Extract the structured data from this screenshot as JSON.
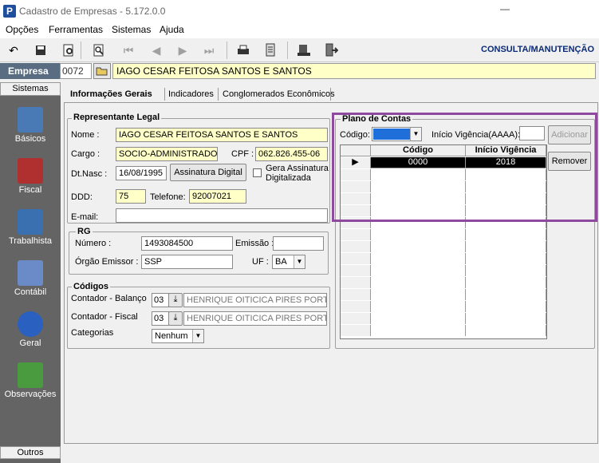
{
  "window": {
    "title": "Cadastro de Empresas - 5.172.0.0",
    "app_icon_letter": "P",
    "minimize_glyph": "—"
  },
  "menu": [
    "Opções",
    "Ferramentas",
    "Sistemas",
    "Ajuda"
  ],
  "toolbar": {
    "mode_label": "CONSULTA/MANUTENÇÃO"
  },
  "empresa": {
    "label": "Empresa",
    "code": "0072",
    "name": "IAGO CESAR FEITOSA SANTOS E SANTOS"
  },
  "sidebar": {
    "top_label": "Sistemas",
    "bottom_label": "Outros",
    "items": [
      {
        "label": "Básicos",
        "icon": "books-icon",
        "color": "#4a7ab5"
      },
      {
        "label": "Fiscal",
        "icon": "fiscal-book-icon",
        "color": "#b03030"
      },
      {
        "label": "Trabalhista",
        "icon": "worker-icon",
        "color": "#3a70b0"
      },
      {
        "label": "Contábil",
        "icon": "calculator-icon",
        "color": "#6a8ac8"
      },
      {
        "label": "Geral",
        "icon": "info-icon",
        "color": "#2a60c0"
      },
      {
        "label": "Observações",
        "icon": "pen-paper-icon",
        "color": "#4a9a40"
      }
    ]
  },
  "tabs": [
    "Informações Gerais",
    "Indicadores",
    "Conglomerados Econômicos"
  ],
  "representante": {
    "legend": "Representante Legal",
    "nome_label": "Nome :",
    "nome": "IAGO CESAR FEITOSA SANTOS E SANTOS",
    "cargo_label": "Cargo :",
    "cargo": "SOCIO-ADMINISTRADOR",
    "cpf_label": "CPF :",
    "cpf": "062.826.455-06",
    "dtnasc_label": "Dt.Nasc :",
    "dtnasc": "16/08/1995",
    "assinatura_button": "Assinatura Digital",
    "gera_assinatura": "Gera Assinatura Digitalizada",
    "ddd_label": "DDD:",
    "ddd": "75",
    "telefone_label": "Telefone:",
    "telefone": "92007021",
    "email_label": "E-mail:",
    "email": ""
  },
  "rg": {
    "legend": "RG",
    "numero_label": "Número :",
    "numero": "1493084500",
    "emissao_label": "Emissão :",
    "emissao": "",
    "orgao_label": "Órgão Emissor :",
    "orgao": "SSP",
    "uf_label": "UF :",
    "uf": "BA"
  },
  "codigos": {
    "legend": "Códigos",
    "balanco_label": "Contador - Balanço",
    "balanco_code": "03",
    "balanco_name": "HENRIQUE OITICICA PIRES PORTO",
    "fiscal_label": "Contador - Fiscal",
    "fiscal_code": "03",
    "fiscal_name": "HENRIQUE OITICICA PIRES PORTO",
    "categorias_label": "Categorias",
    "categorias": "Nenhum"
  },
  "plano": {
    "legend": "Plano de Contas",
    "codigo_label": "Código:",
    "vigencia_label": "Início Vigência(AAAA):",
    "adicionar": "Adicionar",
    "remover": "Remover",
    "col_codigo": "Código",
    "col_vigencia": "Início Vigência",
    "rows": [
      {
        "codigo": "0000",
        "vigencia": "2018"
      }
    ]
  }
}
